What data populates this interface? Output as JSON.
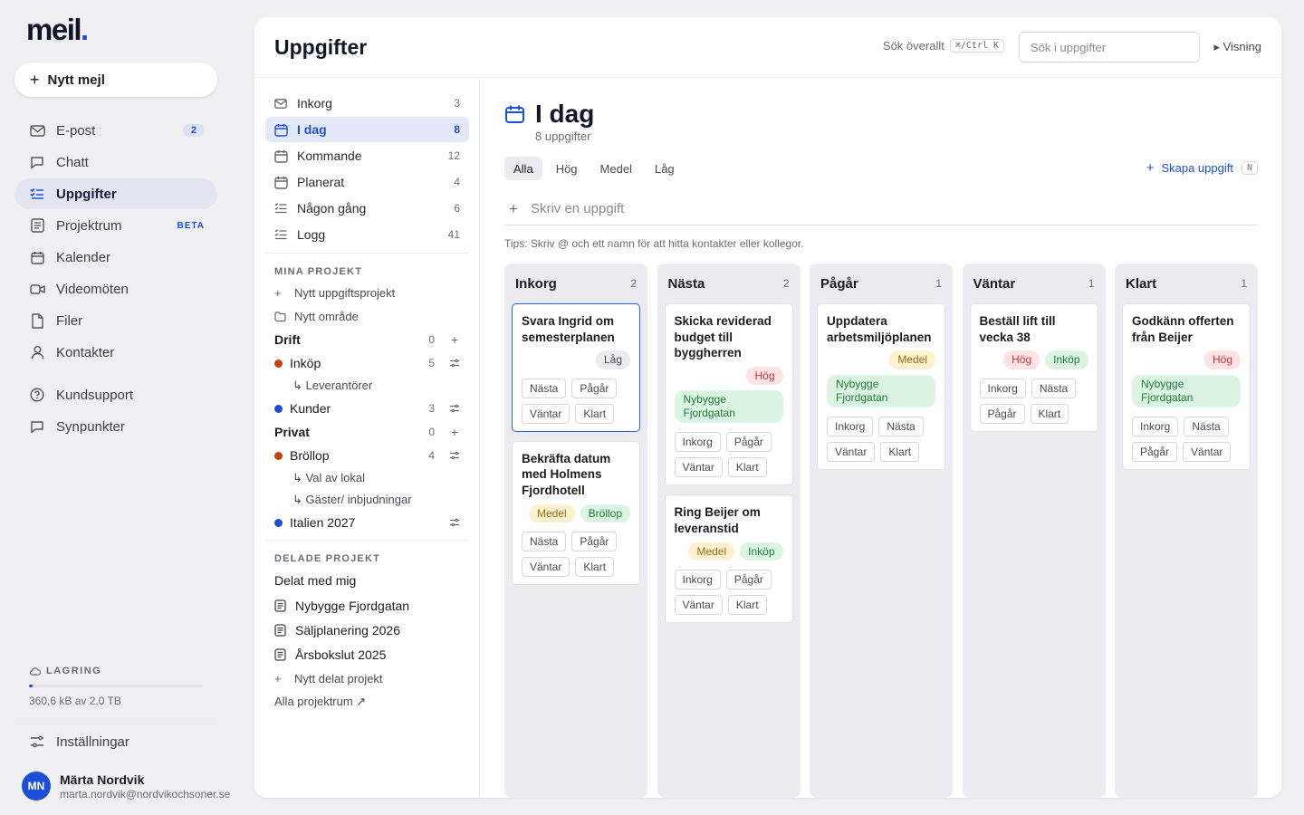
{
  "app": {
    "logo": "meil",
    "logo_dot": ".",
    "new_mail_label": "Nytt mejl",
    "nav": [
      {
        "label": "E-post",
        "icon": "mail-icon",
        "badge": "2"
      },
      {
        "label": "Chatt",
        "icon": "chat-icon"
      },
      {
        "label": "Uppgifter",
        "icon": "tasks-icon",
        "active": true
      },
      {
        "label": "Projektrum",
        "icon": "project-icon",
        "tag": "BETA"
      },
      {
        "label": "Kalender",
        "icon": "calendar-icon"
      },
      {
        "label": "Videomöten",
        "icon": "video-icon"
      },
      {
        "label": "Filer",
        "icon": "file-icon"
      },
      {
        "label": "Kontakter",
        "icon": "person-icon"
      }
    ],
    "nav_support": [
      {
        "label": "Kundsupport",
        "icon": "help-icon"
      },
      {
        "label": "Synpunkter",
        "icon": "feedback-icon"
      }
    ],
    "storage": {
      "title": "LAGRING",
      "text": "360,6 kB av 2,0 TB",
      "fraction": 0.02
    },
    "settings_label": "Inställningar",
    "user": {
      "initials": "MN",
      "name": "Märta Nordvik",
      "email": "marta.nordvik@nordvikochsoner.se"
    }
  },
  "header": {
    "title": "Uppgifter",
    "search_all": "Sök överallt",
    "search_all_kbd": "⌘/Ctrl K",
    "search_placeholder": "Sök i uppgifter",
    "view_toggle": "▸ Visning"
  },
  "subnav": {
    "lists": [
      {
        "label": "Inkorg",
        "count": "3",
        "icon": "inbox-icon"
      },
      {
        "label": "I dag",
        "count": "8",
        "icon": "calendar-icon",
        "active": true
      },
      {
        "label": "Kommande",
        "count": "12",
        "icon": "calendar-icon"
      },
      {
        "label": "Planerat",
        "count": "4",
        "icon": "calendar-icon"
      },
      {
        "label": "Någon gång",
        "count": "6",
        "icon": "list-icon"
      },
      {
        "label": "Logg",
        "count": "41",
        "icon": "list-icon"
      }
    ],
    "my_projects_label": "MINA PROJEKT",
    "new_task_project": "Nytt uppgiftsprojekt",
    "new_area": "Nytt område",
    "groups": [
      {
        "name": "Drift",
        "count": "0",
        "areas": [
          {
            "name": "Inköp",
            "count": "5",
            "color": "#c2410c",
            "children": [
              "↳ Leverantörer"
            ]
          },
          {
            "name": "Kunder",
            "count": "3",
            "color": "#1d4ed8",
            "children": []
          }
        ]
      },
      {
        "name": "Privat",
        "count": "0",
        "areas": [
          {
            "name": "Bröllop",
            "count": "4",
            "color": "#c2410c",
            "children": [
              "↳ Val av lokal",
              "↳ Gäster/ inbjudningar"
            ]
          },
          {
            "name": "Italien 2027",
            "count": "",
            "color": "#1d4ed8",
            "children": []
          }
        ]
      }
    ],
    "shared_label": "DELADE PROJEKT",
    "shared_head": "Delat med mig",
    "shared": [
      "Nybygge Fjordgatan",
      "Säljplanering 2026",
      "Årsbokslut 2025"
    ],
    "new_shared": "Nytt delat projekt",
    "all_projects": "Alla projektrum ↗"
  },
  "content": {
    "title": "I dag",
    "subtitle": "8 uppgifter",
    "filters": [
      "Alla",
      "Hög",
      "Medel",
      "Låg"
    ],
    "active_filter": "Alla",
    "create_label": "Skapa uppgift",
    "create_kbd": "N",
    "quick_add_placeholder": "Skriv en uppgift",
    "tip": "Tips: Skriv @ och ett namn för att hitta kontakter eller kollegor."
  },
  "board": {
    "columns": [
      {
        "title": "Inkorg",
        "count": "2",
        "cards": [
          {
            "title": "Svara Ingrid om semesterplanen",
            "tags": [
              {
                "text": "Låg",
                "kind": "low"
              }
            ],
            "moves": [
              "Nästa",
              "Pågår",
              "Väntar",
              "Klart"
            ],
            "selected": true
          },
          {
            "title": "Bekräfta datum med Holmens Fjordhotell",
            "tags": [
              {
                "text": "Medel",
                "kind": "med"
              },
              {
                "text": "Bröllop",
                "kind": "proj"
              }
            ],
            "moves": [
              "Nästa",
              "Pågår",
              "Väntar",
              "Klart"
            ]
          }
        ]
      },
      {
        "title": "Nästa",
        "count": "2",
        "cards": [
          {
            "title": "Skicka reviderad budget till byggherren",
            "tags": [
              {
                "text": "Hög",
                "kind": "high"
              },
              {
                "text": "Nybygge Fjordgatan",
                "kind": "proj",
                "wide": true
              }
            ],
            "moves": [
              "Inkorg",
              "Pågår",
              "Väntar",
              "Klart"
            ]
          },
          {
            "title": "Ring Beijer om leveranstid",
            "tags": [
              {
                "text": "Medel",
                "kind": "med"
              },
              {
                "text": "Inköp",
                "kind": "proj"
              }
            ],
            "moves": [
              "Inkorg",
              "Pågår",
              "Väntar",
              "Klart"
            ]
          }
        ]
      },
      {
        "title": "Pågår",
        "count": "1",
        "cards": [
          {
            "title": "Uppdatera arbetsmiljöplanen",
            "tags": [
              {
                "text": "Medel",
                "kind": "med"
              },
              {
                "text": "Nybygge Fjordgatan",
                "kind": "proj",
                "wide": true
              }
            ],
            "moves": [
              "Inkorg",
              "Nästa",
              "Väntar",
              "Klart"
            ]
          }
        ]
      },
      {
        "title": "Väntar",
        "count": "1",
        "cards": [
          {
            "title": "Beställ lift till vecka 38",
            "tags": [
              {
                "text": "Hög",
                "kind": "high"
              },
              {
                "text": "Inköp",
                "kind": "proj"
              }
            ],
            "moves": [
              "Inkorg",
              "Nästa",
              "Pågår",
              "Klart"
            ]
          }
        ]
      },
      {
        "title": "Klart",
        "count": "1",
        "cards": [
          {
            "title": "Godkänn offerten från Beijer",
            "tags": [
              {
                "text": "Hög",
                "kind": "high"
              },
              {
                "text": "Nybygge Fjordgatan",
                "kind": "proj",
                "wide": true
              }
            ],
            "moves": [
              "Inkorg",
              "Nästa",
              "Pågår",
              "Väntar"
            ]
          }
        ]
      }
    ]
  }
}
